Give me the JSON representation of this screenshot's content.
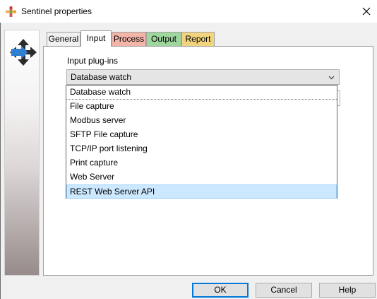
{
  "window": {
    "title": "Sentinel properties",
    "app_icon": "sentinel-app-icon",
    "close_glyph": "×"
  },
  "side": {
    "icon": "move-arrows-icon"
  },
  "tabs": [
    {
      "label": "General",
      "color": "#f0f0f0",
      "active": false
    },
    {
      "label": "Input",
      "color": "#ffffff",
      "active": true
    },
    {
      "label": "Process",
      "color": "#f4b4a8",
      "active": false
    },
    {
      "label": "Output",
      "color": "#9ed69e",
      "active": false
    },
    {
      "label": "Report",
      "color": "#f3d47e",
      "active": false
    }
  ],
  "input_tab": {
    "label": "Input plug-ins",
    "selected_value": "Database watch",
    "options": [
      "Database watch",
      "File capture",
      "Modbus server",
      "SFTP File capture",
      "TCP/IP port listening",
      "Print capture",
      "Web Server",
      "REST Web Server API"
    ],
    "highlighted_option": "REST Web Server API"
  },
  "buttons": {
    "ok": "OK",
    "cancel": "Cancel",
    "help": "Help"
  },
  "colors": {
    "selection": "#cce8ff",
    "accent": "#0078d7",
    "arrow_blue": "#2f7fd3"
  }
}
